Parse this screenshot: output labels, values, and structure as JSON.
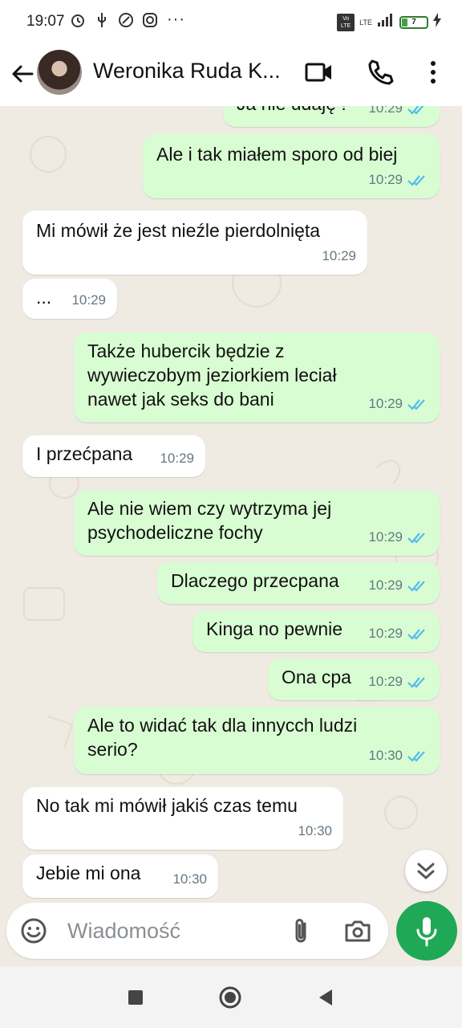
{
  "status_bar": {
    "time": "19:07",
    "more": "···",
    "volte": "Vo LTE",
    "lte": "LTE",
    "battery": "7"
  },
  "header": {
    "contact_name": "Weronika Ruda K...",
    "icons": [
      "back-arrow-icon",
      "video-call-icon",
      "phone-icon",
      "more-vert-icon"
    ]
  },
  "messages": [
    {
      "dir": "out",
      "text": "Ja nie udaję !",
      "time": "10:29",
      "read": true
    },
    {
      "dir": "out",
      "text": "Ale i tak miałem sporo od biej",
      "time": "10:29",
      "read": true
    },
    {
      "dir": "in",
      "text": "Mi mówił że jest nieźle pierdolnięta",
      "time": "10:29"
    },
    {
      "dir": "in",
      "text": "...",
      "time": "10:29"
    },
    {
      "dir": "out",
      "lines": [
        "Także hubercik będzie z",
        "wywieczobym jeziorkiem leciał",
        "nawet jak seks do bani"
      ],
      "time": "10:29",
      "read": true
    },
    {
      "dir": "in",
      "text": "I przećpana",
      "time": "10:29"
    },
    {
      "dir": "out",
      "lines": [
        "Ale nie wiem czy wytrzyma jej",
        "psychodeliczne fochy"
      ],
      "time": "10:29",
      "read": true
    },
    {
      "dir": "out",
      "text": "Dlaczego przecpana",
      "time": "10:29",
      "read": true
    },
    {
      "dir": "out",
      "text": "Kinga no pewnie",
      "time": "10:29",
      "read": true
    },
    {
      "dir": "out",
      "text": "Ona cpa",
      "time": "10:29",
      "read": true
    },
    {
      "dir": "out",
      "lines": [
        "Ale to widać tak dla innycch ludzi",
        "serio?"
      ],
      "time": "10:30",
      "read": true
    },
    {
      "dir": "in",
      "text": "No tak mi mówił jakiś czas temu",
      "time": "10:30"
    },
    {
      "dir": "in",
      "text": "Jebie mi ona",
      "time": "10:30"
    }
  ],
  "composer": {
    "placeholder": "Wiadomość",
    "icons": [
      "emoji-icon",
      "attach-icon",
      "camera-icon",
      "mic-icon"
    ]
  },
  "colors": {
    "outgoing_bubble": "#d9fdd3",
    "incoming_bubble": "#ffffff",
    "chat_background": "#efeae2",
    "accent_green": "#1fa855",
    "read_ticks": "#53bdeb"
  }
}
